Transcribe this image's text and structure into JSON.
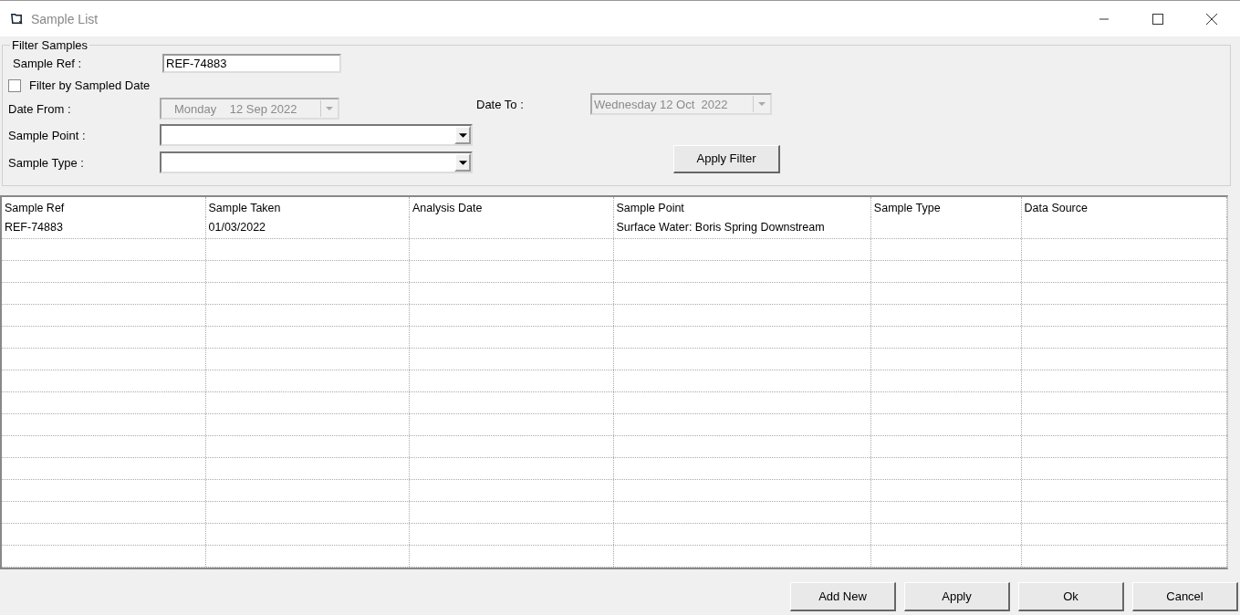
{
  "window": {
    "title": "Sample List"
  },
  "filter": {
    "legend": "Filter Samples",
    "sample_ref": {
      "label": "Sample Ref :",
      "value": "REF-74883"
    },
    "filter_by_date": {
      "label": "Filter by Sampled Date",
      "checked": false
    },
    "date_from": {
      "label": "Date From :",
      "value": "Monday    12 Sep 2022",
      "disabled": true
    },
    "date_to": {
      "label": "Date To :",
      "value": "Wednesday 12 Oct  2022",
      "disabled": true
    },
    "sample_point": {
      "label": "Sample Point :"
    },
    "sample_type": {
      "label": "Sample Type :"
    },
    "apply_filter": "Apply Filter"
  },
  "table": {
    "columns": [
      "Sample Ref",
      "Sample Taken",
      "Analysis Date",
      "Sample Point",
      "Sample Type",
      "Data Source"
    ],
    "rows": [
      [
        "REF-74883",
        "01/03/2022",
        null,
        "Surface Water: Boris Spring Downstream",
        null,
        null
      ]
    ]
  },
  "buttons": [
    "Add New",
    "Apply",
    "Ok",
    "Cancel"
  ]
}
